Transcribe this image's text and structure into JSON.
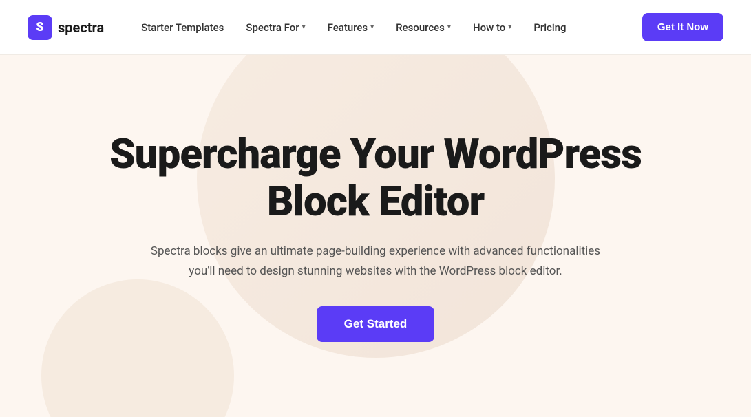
{
  "brand": {
    "logo_letter": "S",
    "logo_name": "spectra"
  },
  "nav": {
    "items": [
      {
        "label": "Starter Templates",
        "has_dropdown": false
      },
      {
        "label": "Spectra For",
        "has_dropdown": true
      },
      {
        "label": "Features",
        "has_dropdown": true
      },
      {
        "label": "Resources",
        "has_dropdown": true
      },
      {
        "label": "How to",
        "has_dropdown": true
      },
      {
        "label": "Pricing",
        "has_dropdown": false
      }
    ],
    "cta_label": "Get It Now"
  },
  "hero": {
    "title_line1": "Supercharge Your WordPress",
    "title_line2": "Block Editor",
    "subtitle": "Spectra blocks give an ultimate page-building experience with advanced functionalities you'll need to design stunning websites with the WordPress block editor.",
    "cta_label": "Get Started"
  },
  "colors": {
    "accent": "#5b3cf6",
    "bg": "#fdf6f0"
  }
}
